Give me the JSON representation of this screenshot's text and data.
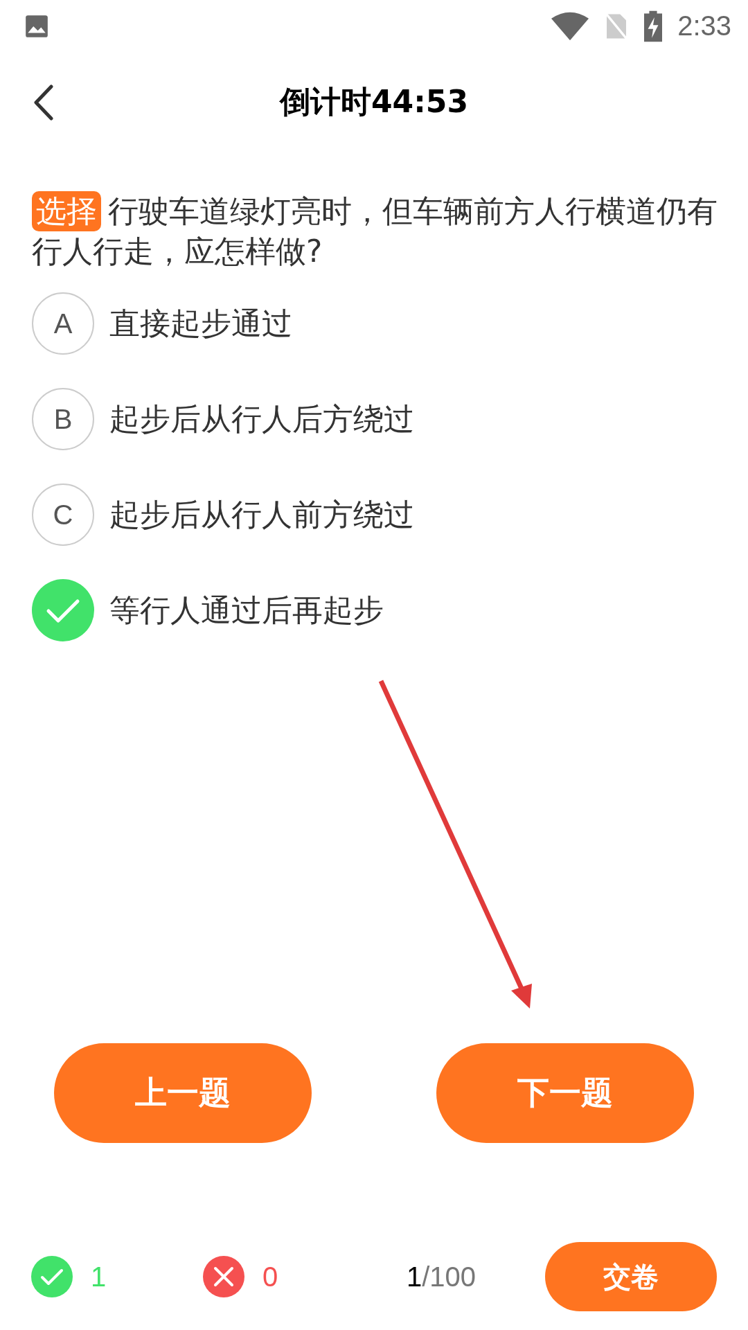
{
  "status_bar": {
    "time": "2:33"
  },
  "header": {
    "title": "倒计时44:53"
  },
  "question": {
    "tag": "选择",
    "text": "行驶车道绿灯亮时，但车辆前方人行横道仍有行人行走，应怎样做?"
  },
  "options": [
    {
      "label": "A",
      "text": "直接起步通过",
      "selected": false
    },
    {
      "label": "B",
      "text": "起步后从行人后方绕过",
      "selected": false
    },
    {
      "label": "C",
      "text": "起步后从行人前方绕过",
      "selected": false
    },
    {
      "text": "等行人通过后再起步",
      "selected": true
    }
  ],
  "nav_buttons": [
    "上一题",
    "下一题"
  ],
  "footer": {
    "correct_count": "1",
    "wrong_count": "0",
    "current": "1",
    "total": "/100",
    "submit": "交卷"
  }
}
